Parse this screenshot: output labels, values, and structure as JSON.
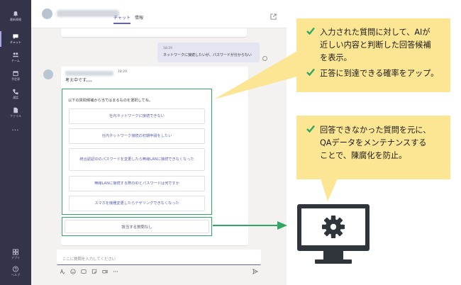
{
  "rail": {
    "items": [
      {
        "label": "最新情報",
        "icon": "bell-icon"
      },
      {
        "label": "チャット",
        "icon": "chat-icon"
      },
      {
        "label": "チーム",
        "icon": "teams-icon"
      },
      {
        "label": "予定表",
        "icon": "calendar-icon"
      },
      {
        "label": "通話",
        "icon": "phone-icon"
      },
      {
        "label": "ファイル",
        "icon": "file-icon"
      }
    ],
    "more": "…",
    "apps": "アプリ",
    "help": "ヘルプ"
  },
  "header": {
    "tabs": [
      "チャット",
      "情報"
    ]
  },
  "messages": {
    "user": {
      "time": "18:29",
      "text": "ネットワークに接続したいが、パスワードが分からない"
    },
    "bot": {
      "time": "18:29",
      "thinking": "考え中です。。。"
    }
  },
  "candidates": {
    "prompt": "以下の質問候補から当てはまるものを選択してね。",
    "items": [
      "社内ネットワークに接続できない",
      "社内ネットワーク接続の初期申請をしたい",
      "統合認証IDのパスワードを変更したら無線LANに接続できなくなった",
      "無線LANに接続する際のIDとパスワードは何ですか",
      "スマホを機種変更したらテザリングできなくなった"
    ],
    "none": "該当する質問なし"
  },
  "compose": {
    "placeholder": "ここに質問を入力してください"
  },
  "callouts": {
    "top": {
      "lines": [
        "入力された質問に対して、AIが",
        "近しい内容と判断した回答候補",
        "を表示。",
        "正答に到達できる確率をアップ。"
      ]
    },
    "bottom": {
      "lines": [
        "回答できなかった質問を元に、",
        "QAデータをメンテナンスする",
        "ことで、陳腐化を防止。"
      ]
    }
  },
  "colors": {
    "rail": "#33344a",
    "accent": "#6264a7",
    "highlight": "#2ea862",
    "callout": "#fce694",
    "monitor": "#30353b"
  }
}
